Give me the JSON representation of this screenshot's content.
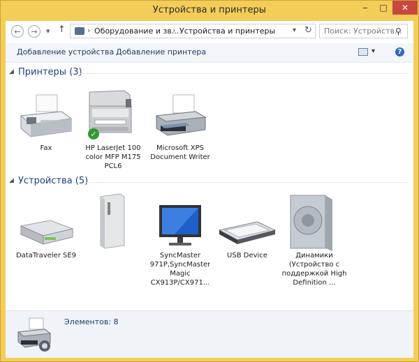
{
  "window": {
    "title": "Устройства и принтеры",
    "minimize_glyph": "‒",
    "maximize_glyph": "□",
    "close_glyph": "✕"
  },
  "navigation": {
    "back_glyph": "←",
    "forward_glyph": "→",
    "recent_glyph": "▾",
    "up_glyph": "↑"
  },
  "address_bar": {
    "segments": [
      "Оборудование и зв...",
      "Устройства и принтеры"
    ],
    "separator": "›",
    "refresh_glyph": "↻",
    "dropdown_glyph": "▾"
  },
  "search": {
    "placeholder": "Поиск: Устройств...",
    "icon": "search-icon",
    "icon_glyph": "⚲"
  },
  "toolbar": {
    "add_device": "Добавление устройства",
    "add_printer": "Добавление принтера",
    "view_drop_glyph": "▾",
    "help_glyph": "?"
  },
  "groups": {
    "printers": {
      "title": "Принтеры (3)",
      "items": [
        {
          "label": "Fax",
          "icon": "fax-icon",
          "default": false
        },
        {
          "label": "HP LaserJet 100 color MFP M175 PCL6",
          "icon": "mfp-printer-icon",
          "default": true
        },
        {
          "label": "Microsoft XPS Document Writer",
          "icon": "printer-icon",
          "default": false
        }
      ]
    },
    "devices": {
      "title": "Устройства (5)",
      "items": [
        {
          "label": "DataTraveler SE9",
          "icon": "usb-drive-icon"
        },
        {
          "label": "",
          "icon": "computer-tower-icon"
        },
        {
          "label": "SyncMaster 971P,SyncMaster Magic CX913P/CX971...",
          "icon": "monitor-icon"
        },
        {
          "label": "USB Device",
          "icon": "keyboard-icon"
        },
        {
          "label": "Динамики (Устройство с поддержкой High Definition ...",
          "icon": "speaker-icon"
        }
      ]
    }
  },
  "collapse_glyph": "◢",
  "status": {
    "text": "Элементов: 8"
  },
  "colors": {
    "title_bar": "#f3cd57",
    "close_button": "#c9483d",
    "group_title": "#1e3f82",
    "accent_link": "#1e3b63"
  }
}
